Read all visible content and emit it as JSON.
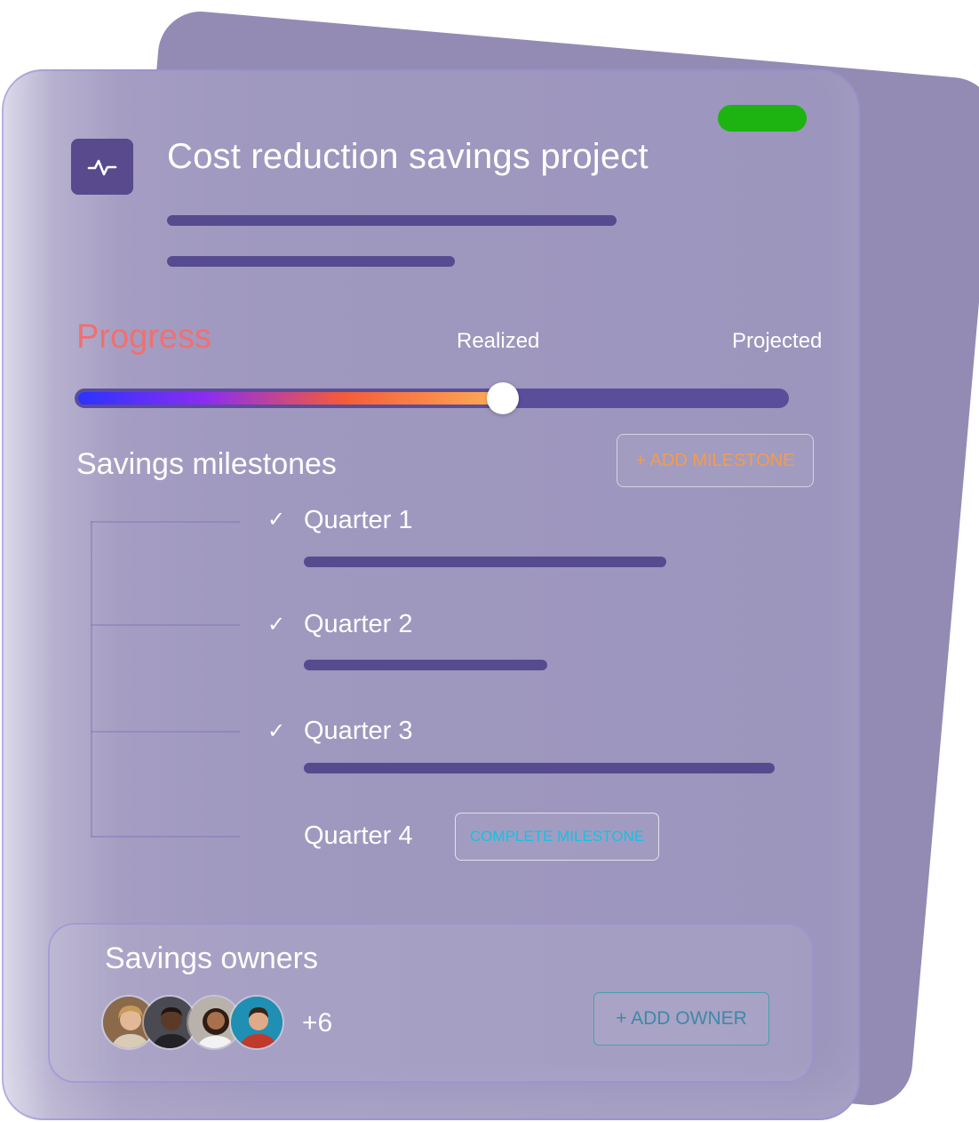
{
  "project": {
    "title": "Cost reduction savings project",
    "icon": "activity-icon",
    "status_color": "#1db311"
  },
  "progress": {
    "label": "Progress",
    "realized_label": "Realized",
    "projected_label": "Projected",
    "realized_fraction": 0.6
  },
  "milestones": {
    "title": "Savings milestones",
    "add_button_label": "+ ADD MILESTONE",
    "items": [
      {
        "label": "Quarter 1",
        "completed": true
      },
      {
        "label": "Quarter 2",
        "completed": true
      },
      {
        "label": "Quarter 3",
        "completed": true
      },
      {
        "label": "Quarter 4",
        "completed": false
      }
    ],
    "complete_button_label": "COMPLETE MILESTONE",
    "check_glyph": "✓"
  },
  "owners": {
    "title": "Savings owners",
    "extra_count": "+6",
    "add_button_label": "+ ADD OWNER"
  },
  "colors": {
    "card": "#9c95bd",
    "accent_bar": "#574b8f",
    "progress_label": "#f07070",
    "add_milestone_text": "#f49b4c",
    "complete_text": "#11c3e3",
    "add_owner_text": "#3f88a8"
  }
}
